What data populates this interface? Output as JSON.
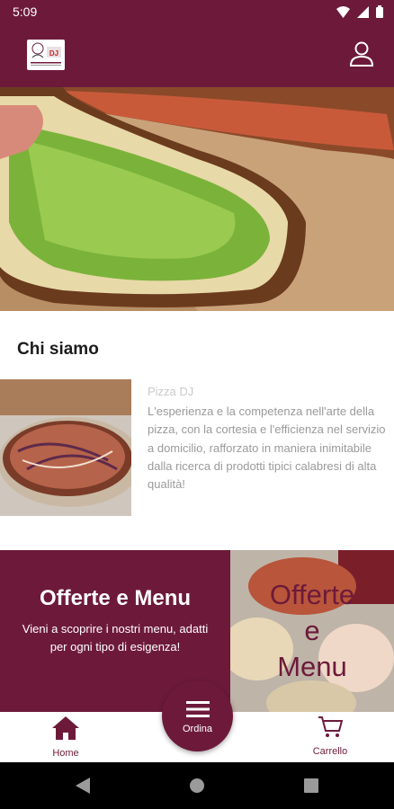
{
  "status_bar": {
    "time": "5:09",
    "icons": [
      "wifi-icon",
      "signal-icon",
      "battery-icon"
    ]
  },
  "app_bar": {
    "logo_text": "DJ",
    "user_icon": "user-icon"
  },
  "about": {
    "heading": "Chi siamo",
    "name": "Pizza DJ",
    "text": "L'esperienza e la competenza nell'arte della pizza, con la cortesia e l'efficienza nel servizio a domicilio, rafforzato in maniera inimitabile dalla ricerca di prodotti tipici calabresi di alta qualità!"
  },
  "promo": {
    "title": "Offerte e Menu",
    "subtitle": "Vieni a scoprire i nostri menu, adatti per ogni tipo di esigenza!",
    "image_text_1": "Offerte",
    "image_text_2": "e",
    "image_text_3": "Menu"
  },
  "bottom_nav": {
    "home_label": "Home",
    "order_label": "Ordina",
    "cart_label": "Carrello"
  },
  "colors": {
    "brand": "#6d1a3a",
    "text_muted": "#9a9a9a"
  }
}
